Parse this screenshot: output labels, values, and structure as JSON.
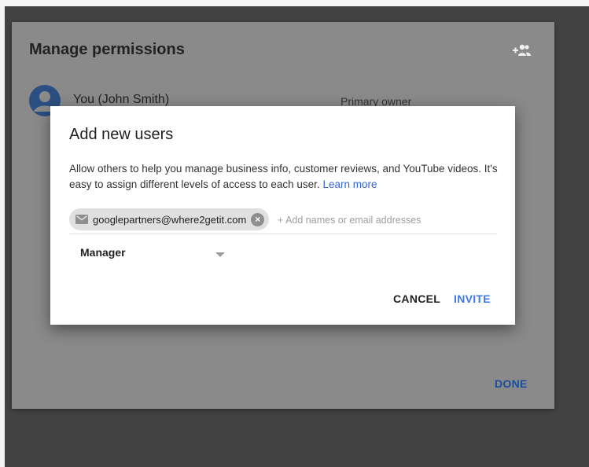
{
  "background_dialog": {
    "title": "Manage permissions",
    "add_user_icon": "person-add-icon",
    "owner": {
      "avatar_icon": "account-circle-icon",
      "name": "You (John Smith)",
      "role": "Primary owner"
    },
    "done_label": "DONE"
  },
  "add_dialog": {
    "title": "Add new users",
    "description": "Allow others to help you manage business info, customer reviews, and YouTube videos. It's easy to assign different levels of access to each user.",
    "learn_more": "Learn more",
    "chip": {
      "icon": "email-icon",
      "email": "googlepartners@where2getit.com",
      "remove_icon": "remove-chip-icon"
    },
    "input": {
      "value": "",
      "placeholder": "+ Add names or email addresses"
    },
    "role": {
      "selected": "Manager",
      "caret_icon": "caret-down-icon"
    },
    "cancel_label": "CANCEL",
    "invite_label": "INVITE"
  },
  "colors": {
    "accent": "#3b78e7",
    "overlay": "#424242",
    "chip": "#e0e0e0"
  }
}
